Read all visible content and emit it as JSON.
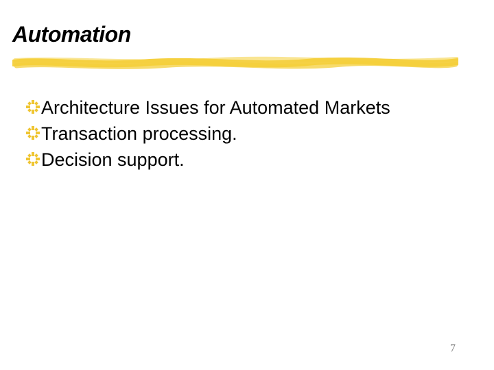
{
  "slide": {
    "title": "Automation",
    "bullets": [
      {
        "text": "Architecture Issues for Automated Markets"
      },
      {
        "text": "Transaction processing."
      },
      {
        "text": "Decision support."
      }
    ],
    "page_number": "7"
  },
  "colors": {
    "underline": "#f4cf3b",
    "bullet_icon": "#efc532"
  }
}
